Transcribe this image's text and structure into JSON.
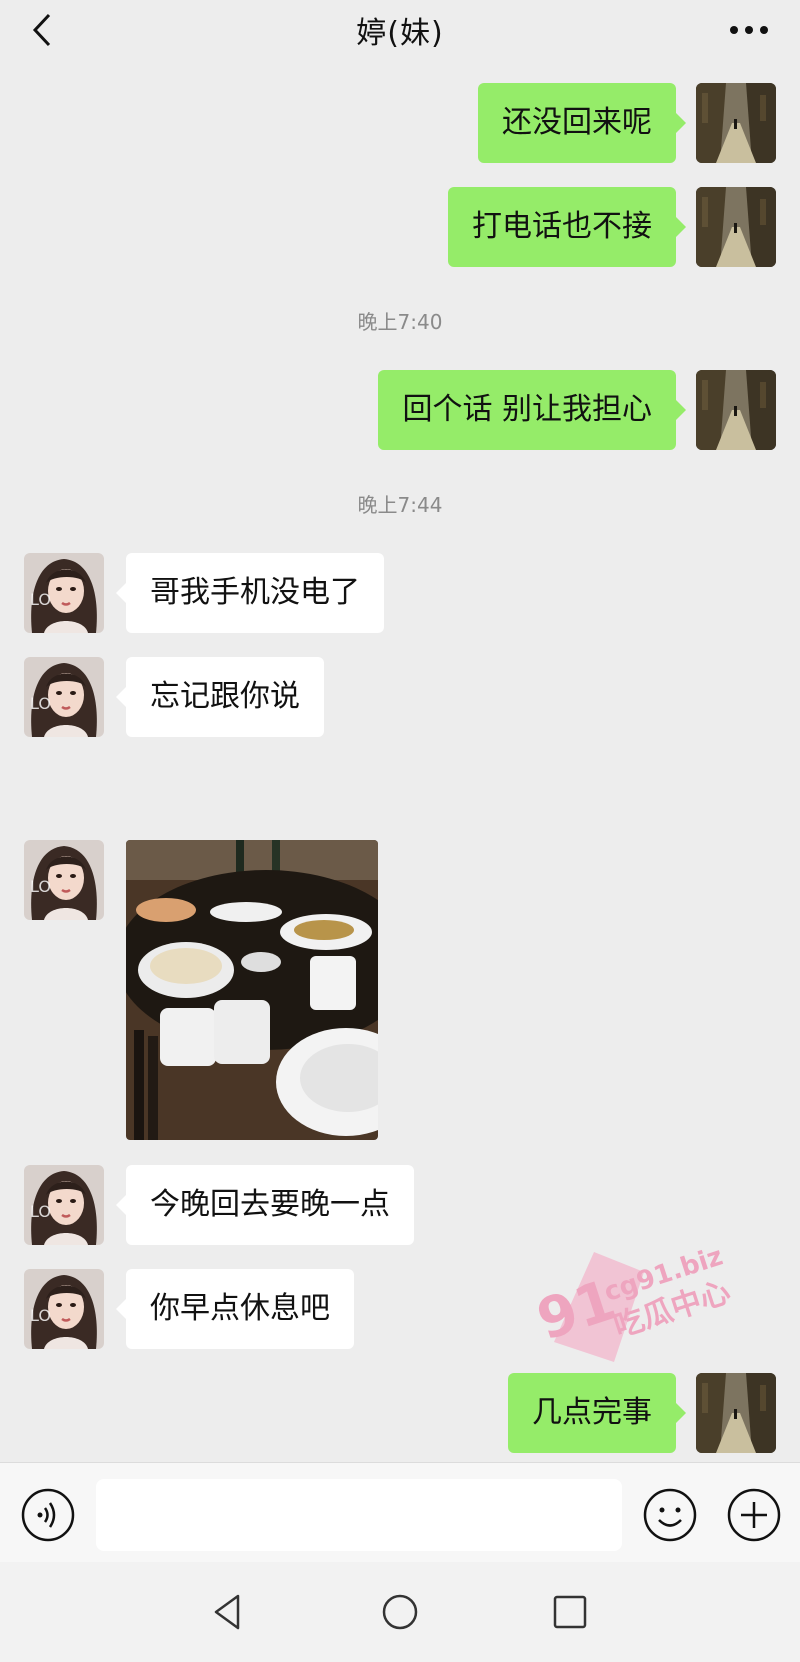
{
  "header": {
    "title": "婷(妹)"
  },
  "messages": [
    {
      "text": "还没回来呢"
    },
    {
      "text": "打电话也不接"
    },
    {
      "text": "回个话 别让我担心"
    },
    {
      "text": "哥我手机没电了"
    },
    {
      "text": "忘记跟你说"
    },
    {
      "text": "今晚回去要晚一点"
    },
    {
      "text": "你早点休息吧"
    },
    {
      "text": "几点完事"
    }
  ],
  "timestamps": [
    "晚上7:40",
    "晚上7:44"
  ],
  "input": {
    "placeholder": ""
  },
  "watermark": {
    "number": "91",
    "domain": "cg91.biz",
    "label": "吃瓜中心"
  },
  "colors": {
    "outgoing_bubble": "#95ec69",
    "incoming_bubble": "#ffffff",
    "background": "#ededed",
    "watermark": "#f06b9a"
  }
}
